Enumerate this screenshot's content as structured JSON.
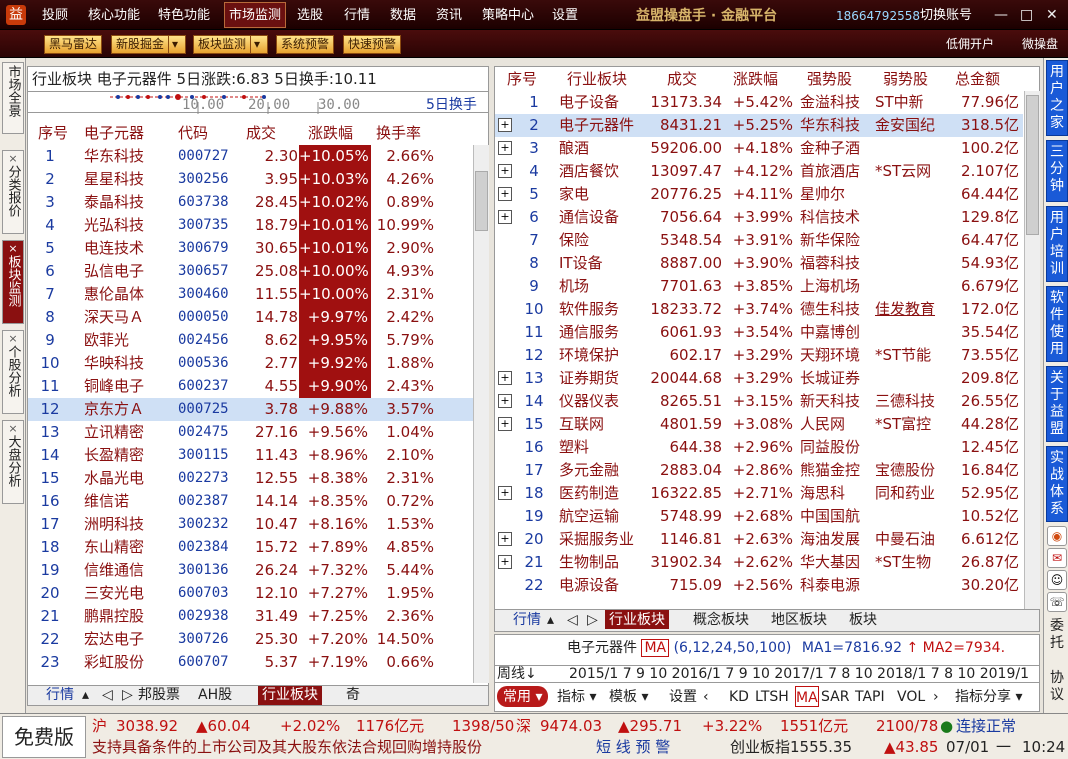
{
  "app": {
    "brand": "益盟操盘手 · 金融平台",
    "phone": "18664792558",
    "switch_account": "切换账号",
    "icon": "app-logo-icon"
  },
  "menu": [
    "投顾",
    "核心功能",
    "特色功能",
    "市场监测",
    "选股",
    "行情",
    "数据",
    "资讯",
    "策略中心",
    "设置"
  ],
  "toolbar": {
    "buttons": [
      "黑马雷达",
      "新股掘金",
      "板块监测",
      "系统预警",
      "快速预警"
    ],
    "right": [
      "低佣开户",
      "微操盘"
    ]
  },
  "left_tabs": [
    "市场全景",
    "分类报价",
    "板块监测",
    "个股分析",
    "大盘分析"
  ],
  "right_tabs": [
    "用户之家",
    "三分钟",
    "用户培训",
    "软件使用",
    "关于益盟",
    "实战体系"
  ],
  "right_extra": [
    "委托",
    "协议"
  ],
  "left_panel": {
    "header": "行业板块  电子元器件  5日涨跌:6.83  5日换手:10.11",
    "scale": [
      "10.00",
      "20.00",
      "30.00"
    ],
    "scale_label": "5日换手",
    "columns": [
      "序号",
      "电子元器",
      "代码",
      "成交",
      "涨跌幅",
      "换手率"
    ],
    "rows": [
      [
        "1",
        "华东科技",
        "000727",
        "2.30",
        "+10.05%",
        "2.66%"
      ],
      [
        "2",
        "星星科技",
        "300256",
        "3.95",
        "+10.03%",
        "4.26%"
      ],
      [
        "3",
        "泰晶科技",
        "603738",
        "28.45",
        "+10.02%",
        "0.89%"
      ],
      [
        "4",
        "光弘科技",
        "300735",
        "18.79",
        "+10.01%",
        "10.99%"
      ],
      [
        "5",
        "电连技术",
        "300679",
        "30.65",
        "+10.01%",
        "2.90%"
      ],
      [
        "6",
        "弘信电子",
        "300657",
        "25.08",
        "+10.00%",
        "4.93%"
      ],
      [
        "7",
        "惠伦晶体",
        "300460",
        "11.55",
        "+10.00%",
        "2.31%"
      ],
      [
        "8",
        "深天马Ａ",
        "000050",
        "14.78",
        "+9.97%",
        "2.42%"
      ],
      [
        "9",
        "欧菲光",
        "002456",
        "8.62",
        "+9.95%",
        "5.79%"
      ],
      [
        "10",
        "华映科技",
        "000536",
        "2.77",
        "+9.92%",
        "1.88%"
      ],
      [
        "11",
        "铜峰电子",
        "600237",
        "4.55",
        "+9.90%",
        "2.43%"
      ],
      [
        "12",
        "京东方Ａ",
        "000725",
        "3.78",
        "+9.88%",
        "3.57%"
      ],
      [
        "13",
        "立讯精密",
        "002475",
        "27.16",
        "+9.56%",
        "1.04%"
      ],
      [
        "14",
        "长盈精密",
        "300115",
        "11.43",
        "+8.96%",
        "2.10%"
      ],
      [
        "15",
        "水晶光电",
        "002273",
        "12.55",
        "+8.38%",
        "2.31%"
      ],
      [
        "16",
        "维信诺",
        "002387",
        "14.14",
        "+8.35%",
        "0.72%"
      ],
      [
        "17",
        "洲明科技",
        "300232",
        "10.47",
        "+8.16%",
        "1.53%"
      ],
      [
        "18",
        "东山精密",
        "002384",
        "15.72",
        "+7.89%",
        "4.85%"
      ],
      [
        "19",
        "信维通信",
        "300136",
        "26.24",
        "+7.32%",
        "5.44%"
      ],
      [
        "20",
        "三安光电",
        "600703",
        "12.10",
        "+7.27%",
        "1.95%"
      ],
      [
        "21",
        "鹏鼎控股",
        "002938",
        "31.49",
        "+7.25%",
        "2.36%"
      ],
      [
        "22",
        "宏达电子",
        "300726",
        "25.30",
        "+7.20%",
        "14.50%"
      ],
      [
        "23",
        "彩虹股份",
        "600707",
        "5.37",
        "+7.19%",
        "0.66%"
      ]
    ],
    "limit_rows": 11,
    "selected": 12,
    "tabs": [
      "行情",
      "◁",
      "▷",
      "邦股票",
      "AH股",
      "行业板块",
      "奇"
    ]
  },
  "right_panel": {
    "columns": [
      "序号",
      "行业板块",
      "成交",
      "涨跌幅",
      "强势股",
      "弱势股",
      "总金额"
    ],
    "rows": [
      [
        "1",
        "电子设备",
        "13173.34",
        "+5.42%",
        "金溢科技",
        "ST中新",
        "77.96亿",
        false
      ],
      [
        "2",
        "电子元器件",
        "8431.21",
        "+5.25%",
        "华东科技",
        "金安国纪",
        "318.5亿",
        true
      ],
      [
        "3",
        "酿酒",
        "59206.00",
        "+4.18%",
        "金种子酒",
        "",
        "100.2亿",
        true
      ],
      [
        "4",
        "酒店餐饮",
        "13097.47",
        "+4.12%",
        "首旅酒店",
        "*ST云网",
        "2.107亿",
        true
      ],
      [
        "5",
        "家电",
        "20776.25",
        "+4.11%",
        "星帅尔",
        "",
        "64.44亿",
        true
      ],
      [
        "6",
        "通信设备",
        "7056.64",
        "+3.99%",
        "科信技术",
        "",
        "129.8亿",
        true
      ],
      [
        "7",
        "保险",
        "5348.54",
        "+3.91%",
        "新华保险",
        "",
        "64.47亿",
        false
      ],
      [
        "8",
        "IT设备",
        "8887.00",
        "+3.90%",
        "福蓉科技",
        "",
        "54.93亿",
        false
      ],
      [
        "9",
        "机场",
        "7701.63",
        "+3.85%",
        "上海机场",
        "",
        "6.679亿",
        false
      ],
      [
        "10",
        "软件服务",
        "18233.72",
        "+3.74%",
        "德生科技",
        "佳发教育",
        "172.0亿",
        false
      ],
      [
        "11",
        "通信服务",
        "6061.93",
        "+3.54%",
        "中嘉博创",
        "",
        "35.54亿",
        false
      ],
      [
        "12",
        "环境保护",
        "602.17",
        "+3.29%",
        "天翔环境",
        "*ST节能",
        "73.55亿",
        false
      ],
      [
        "13",
        "证券期货",
        "20044.68",
        "+3.29%",
        "长城证券",
        "",
        "209.8亿",
        true
      ],
      [
        "14",
        "仪器仪表",
        "8265.51",
        "+3.15%",
        "新天科技",
        "三德科技",
        "26.55亿",
        true
      ],
      [
        "15",
        "互联网",
        "4801.59",
        "+3.08%",
        "人民网",
        "*ST富控",
        "44.28亿",
        true
      ],
      [
        "16",
        "塑料",
        "644.38",
        "+2.96%",
        "同益股份",
        "",
        "12.45亿",
        false
      ],
      [
        "17",
        "多元金融",
        "2883.04",
        "+2.86%",
        "熊猫金控",
        "宝德股份",
        "16.84亿",
        false
      ],
      [
        "18",
        "医药制造",
        "16322.85",
        "+2.71%",
        "海思科",
        "同和药业",
        "52.95亿",
        true
      ],
      [
        "19",
        "航空运输",
        "5748.99",
        "+2.68%",
        "中国国航",
        "",
        "10.52亿",
        false
      ],
      [
        "20",
        "采掘服务业",
        "1146.81",
        "+2.63%",
        "海油发展",
        "中曼石油",
        "6.612亿",
        true
      ],
      [
        "21",
        "生物制品",
        "31902.34",
        "+2.62%",
        "华大基因",
        "*ST生物",
        "26.87亿",
        true
      ],
      [
        "22",
        "电源设备",
        "715.09",
        "+2.56%",
        "科泰电源",
        "",
        "30.20亿",
        false
      ]
    ],
    "selected": 2,
    "tabs": [
      "行情",
      "◁",
      "▷",
      "行业板块",
      "概念板块",
      "地区板块",
      "板块"
    ]
  },
  "mini_chart": {
    "title": "电子元器件",
    "ma_tag": "MA",
    "params": "(6,12,24,50,100)",
    "ma1": "MA1=7816.92",
    "ma2": "MA2=7934.",
    "period": "周线",
    "timeline": "2015/1 7 9 10 2016/1 7 9 10 2017/1 7 8 10 2018/1 7 8 10 2019/1",
    "buttons": [
      "常用",
      "指标",
      "模板",
      "设置",
      "KD",
      "LTSH",
      "MA",
      "SAR",
      "TAPI",
      "VOL",
      "指标分享"
    ]
  },
  "status": {
    "free": "免费版",
    "sh_label": "沪",
    "sh_index": "3038.92",
    "sh_change": "▲60.04",
    "sh_pct": "+2.02%",
    "sh_amount": "1176亿元",
    "sh_updown": "1398/50",
    "sz_label": "深",
    "sz_index": "9474.03",
    "sz_change": "▲295.71",
    "sz_pct": "+3.22%",
    "sz_amount": "1551亿元",
    "sz_updown": "2100/78",
    "connection": "连接正常",
    "ticker": "支持具备条件的上市公司及其大股东依法合规回购增持股份",
    "alert": "短 线 预 警",
    "cyb": "创业板指1555.35",
    "cyb_change": "▲43.85",
    "date": "07/01",
    "weekday": "一",
    "time": "10:24"
  }
}
